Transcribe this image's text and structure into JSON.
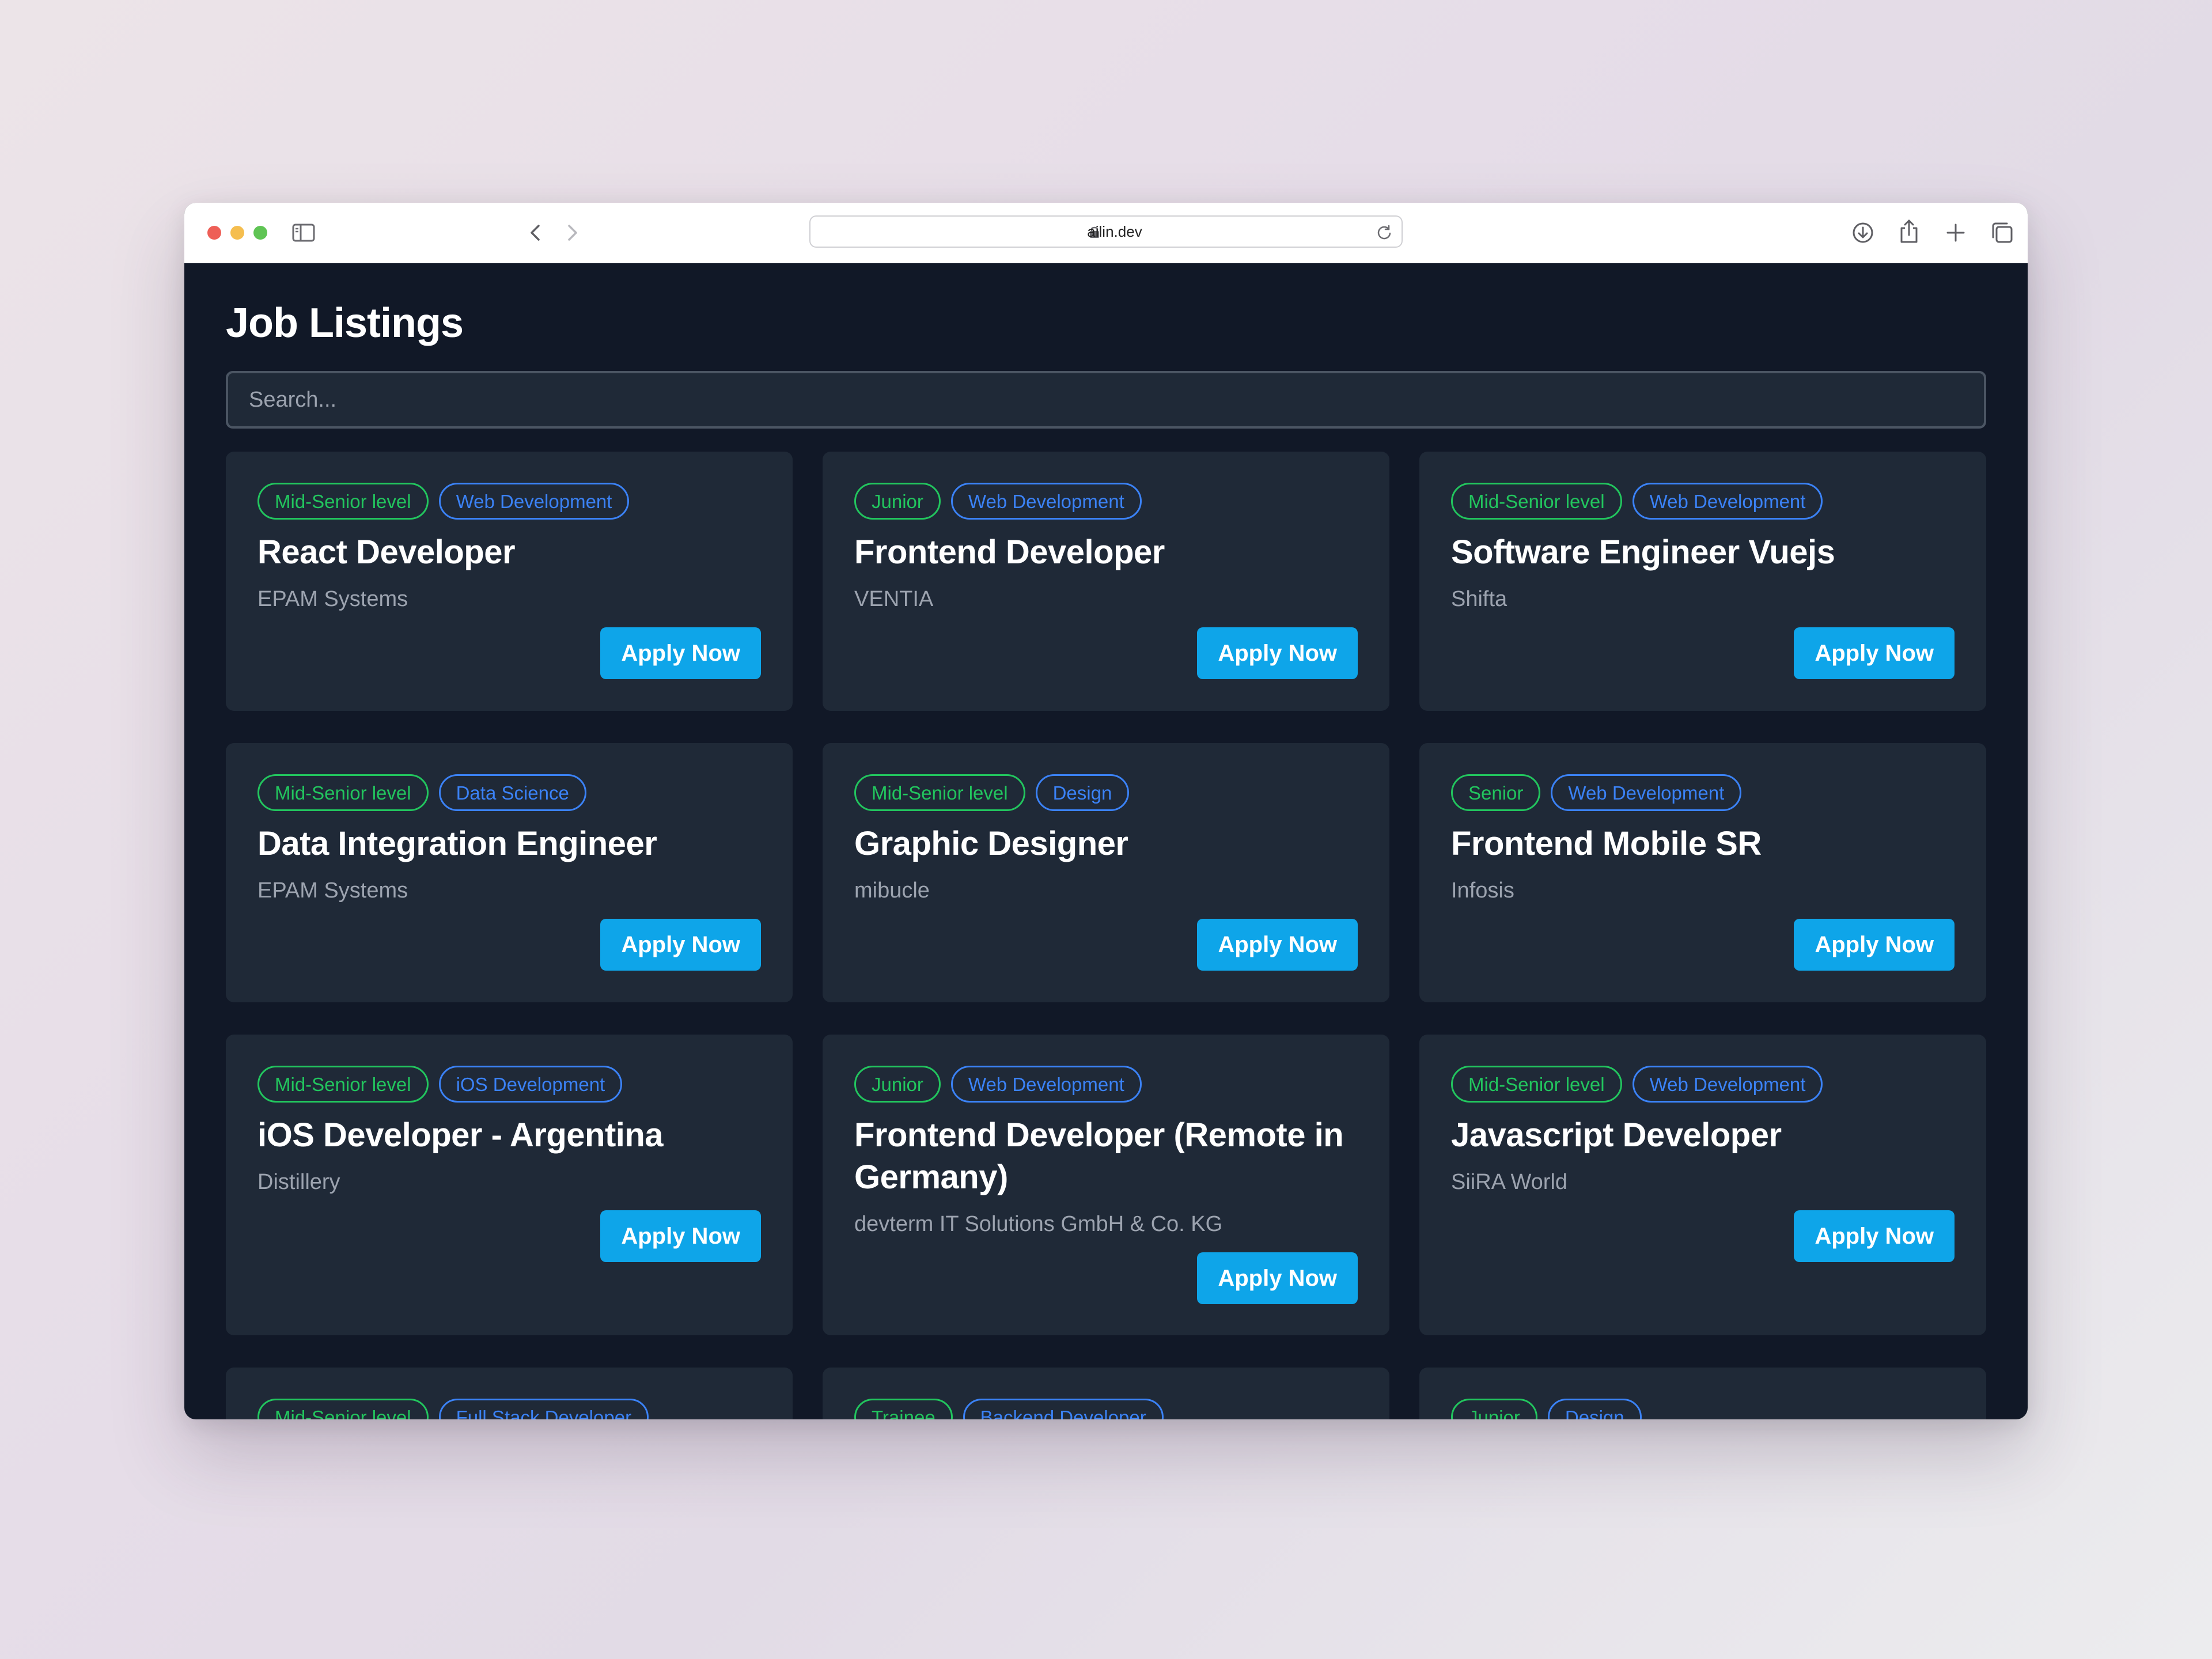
{
  "browser": {
    "url": "ailin.dev"
  },
  "page": {
    "title": "Job Listings",
    "search_placeholder": "Search..."
  },
  "jobs": [
    {
      "level": "Mid-Senior level",
      "category": "Web Development",
      "title": "React Developer",
      "company": "EPAM Systems",
      "apply_label": "Apply Now"
    },
    {
      "level": "Junior",
      "category": "Web Development",
      "title": "Frontend Developer",
      "company": "VENTIA",
      "apply_label": "Apply Now"
    },
    {
      "level": "Mid-Senior level",
      "category": "Web Development",
      "title": "Software Engineer Vuejs",
      "company": "Shifta",
      "apply_label": "Apply Now"
    },
    {
      "level": "Mid-Senior level",
      "category": "Data Science",
      "title": "Data Integration Engineer",
      "company": "EPAM Systems",
      "apply_label": "Apply Now"
    },
    {
      "level": "Mid-Senior level",
      "category": "Design",
      "title": "Graphic Designer",
      "company": "mibucle",
      "apply_label": "Apply Now"
    },
    {
      "level": "Senior",
      "category": "Web Development",
      "title": "Frontend Mobile SR",
      "company": "Infosis",
      "apply_label": "Apply Now"
    },
    {
      "level": "Mid-Senior level",
      "category": "iOS Development",
      "title": "iOS Developer - Argentina",
      "company": "Distillery",
      "apply_label": "Apply Now"
    },
    {
      "level": "Junior",
      "category": "Web Development",
      "title": "Frontend Developer (Remote in Germany)",
      "company": "devterm IT Solutions GmbH & Co. KG",
      "apply_label": "Apply Now"
    },
    {
      "level": "Mid-Senior level",
      "category": "Web Development",
      "title": "Javascript Developer",
      "company": "SiiRA World",
      "apply_label": "Apply Now"
    },
    {
      "level": "Mid-Senior level",
      "category": "Full Stack Developer"
    },
    {
      "level": "Trainee",
      "category": "Backend Developer"
    },
    {
      "level": "Junior",
      "category": "Design"
    }
  ]
}
